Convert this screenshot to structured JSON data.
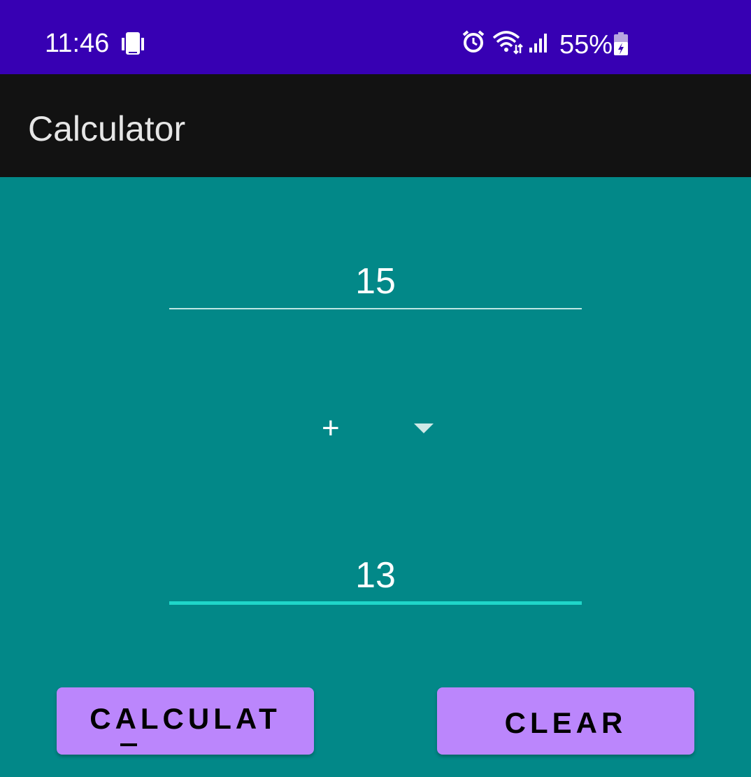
{
  "status_bar": {
    "time": "11:46",
    "battery": "55%",
    "icons": [
      "phone-icon",
      "alarm-icon",
      "wifi-icon",
      "signal-icon",
      "battery-charging-icon"
    ]
  },
  "app_bar": {
    "title": "Calculator"
  },
  "inputs": {
    "first_number": "15",
    "second_number": "13"
  },
  "operator": {
    "selected": "+"
  },
  "buttons": {
    "calculate_label": "CALCULAT",
    "clear_label": "CLEAR"
  },
  "colors": {
    "status_bar": "#3700B3",
    "app_bar": "#121212",
    "background": "#028888",
    "button": "#BB86FC",
    "focused_underline": "#1fd6c9"
  }
}
